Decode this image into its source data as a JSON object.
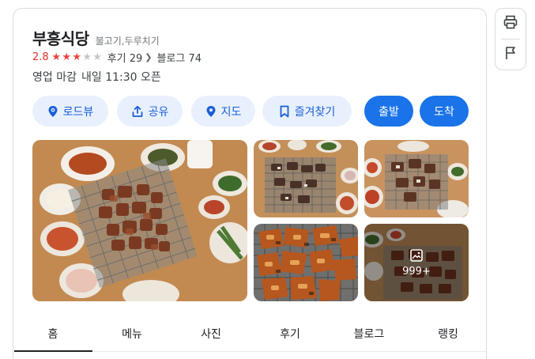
{
  "place": {
    "name": "부흥식당",
    "category": "불고기,두루치기",
    "rating": "2.8",
    "rating_value": 2.8,
    "stars_filled": 3,
    "stars_total": 5,
    "reviews": "후기 29",
    "blog": "블로그 74",
    "status": "영업 마감",
    "next_open": "내일 11:30 오픈"
  },
  "actions": {
    "roadview": "로드뷰",
    "share": "공유",
    "map": "지도",
    "favorite": "즐겨찾기",
    "depart": "출발",
    "arrive": "도착"
  },
  "photos": {
    "more_count": "999+"
  },
  "tabs": [
    "홈",
    "메뉴",
    "사진",
    "후기",
    "블로그",
    "랭킹"
  ],
  "active_tab": "홈",
  "colors": {
    "accent": "#1a73e8",
    "chip_bg": "#e8f0fe",
    "star_on": "#e8453c",
    "rating_text": "#d93025"
  },
  "icons": {
    "print": "print-icon",
    "flag": "flag-icon",
    "roadview": "roadview-pin-icon",
    "share": "share-icon",
    "map": "location-pin-icon",
    "favorite": "bookmark-icon",
    "more_photos": "photo-gallery-icon"
  }
}
